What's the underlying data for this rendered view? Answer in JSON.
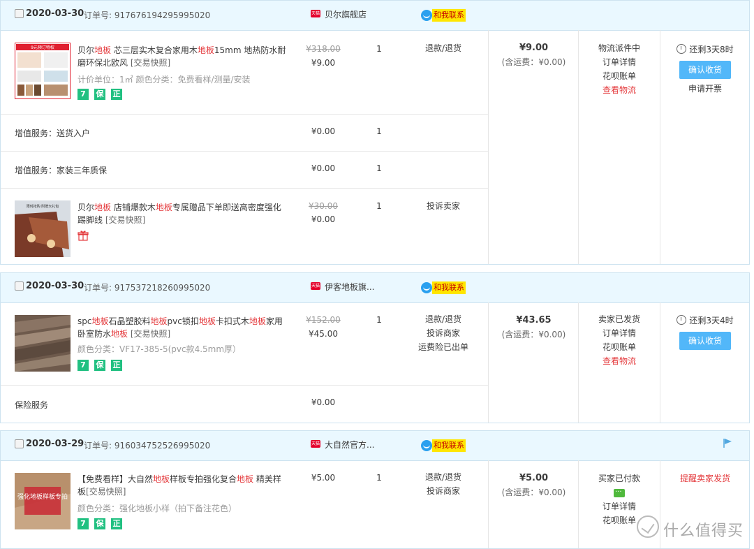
{
  "labels": {
    "order_no": "订单号:",
    "tmall": "天猫",
    "contact": "和我联系",
    "snapshot": "[交易快照]",
    "confirm": "确认收货",
    "shipping_prefix": "(含运费：",
    "shipping_suffix": ")"
  },
  "orders": [
    {
      "date": "2020-03-30",
      "order_no": "917676194295995020",
      "shop": "贝尔旗舰店",
      "items": [
        {
          "name_parts": [
            "贝尔",
            "地板",
            " 芯三层实木复合家用木",
            "地板",
            "15mm 地热防水耐磨环保北欧风 "
          ],
          "sku": "计价单位：1㎡  颜色分类：免费看样/测量/安装",
          "orig_price": "¥318.00",
          "price": "¥9.00",
          "qty": "1",
          "actions": [
            "退款/退货"
          ]
        },
        {
          "service": "增值服务：送货入户",
          "price": "¥0.00",
          "qty": "1"
        },
        {
          "service": "增值服务：家装三年质保",
          "price": "¥0.00",
          "qty": "1"
        },
        {
          "name_parts": [
            "贝尔",
            "地板",
            " 店铺爆款木",
            "地板",
            "专属赠品下单即送高密度强化踢脚线 "
          ],
          "orig_price": "¥30.00",
          "price": "¥0.00",
          "qty": "1",
          "actions": [
            "投诉卖家"
          ]
        }
      ],
      "total": "¥9.00",
      "shipping": "¥0.00",
      "status": [
        "物流派件中",
        "订单详情",
        "花呗账单"
      ],
      "status_link": "查看物流",
      "timer": "还剩3天8时",
      "extra_op": "申请开票"
    },
    {
      "date": "2020-03-30",
      "order_no": "917537218260995020",
      "shop": "伊客地板旗...",
      "items": [
        {
          "name_parts": [
            "spc",
            "地板",
            "石晶塑胶料",
            "地板",
            "pvc锁扣",
            "地板",
            "卡扣式木",
            "地板",
            "家用卧室防水",
            "地板",
            " "
          ],
          "sku": "颜色分类：VF17-385-5(pvc款4.5mm厚）",
          "orig_price": "¥152.00",
          "price": "¥45.00",
          "qty": "1",
          "actions": [
            "退款/退货",
            "投诉商家",
            "运费险已出单"
          ]
        },
        {
          "service": "保险服务",
          "price": "¥0.00"
        }
      ],
      "total": "¥43.65",
      "shipping": "¥0.00",
      "status": [
        "卖家已发货",
        "订单详情",
        "花呗账单"
      ],
      "status_link": "查看物流",
      "timer": "还剩3天4时"
    },
    {
      "date": "2020-03-29",
      "order_no": "916034752526995020",
      "shop": "大自然官方...",
      "items": [
        {
          "name_parts": [
            "【免费看样】大自然",
            "地板",
            "样板专拍强化复合",
            "地板",
            " 精美样板"
          ],
          "sku": "颜色分类：强化地板小样（拍下备注花色）",
          "price": "¥5.00",
          "qty": "1",
          "actions": [
            "退款/退货",
            "投诉商家"
          ]
        }
      ],
      "total": "¥5.00",
      "shipping": "¥0.00",
      "status": [
        "买家已付款",
        "订单详情",
        "花呗账单"
      ],
      "remind": "提醒卖家发货",
      "thumb_text": "强化地板样板专拍"
    }
  ],
  "thumb1": {
    "title": "9元预订特权"
  },
  "thumb2": {
    "title": "限时抢购 附赠大礼包"
  },
  "watermark": "什么值得买",
  "badges": {
    "seven": "7",
    "guarantee": "保",
    "genuine": "正"
  },
  "colors": {
    "accent_red": "#e4393c",
    "header_bg": "#eaf8ff",
    "confirm_btn": "#52b7f9",
    "badge_green": "#21c081"
  }
}
